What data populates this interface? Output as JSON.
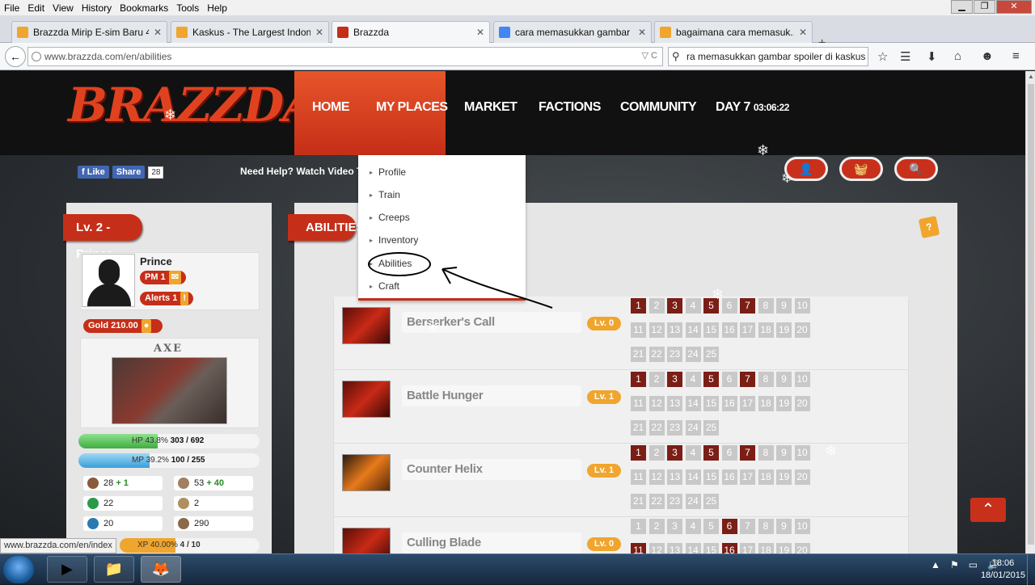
{
  "browser": {
    "menu": [
      "File",
      "Edit",
      "View",
      "History",
      "Bookmarks",
      "Tools",
      "Help"
    ],
    "window_controls": [
      "minimize",
      "restore",
      "close"
    ],
    "tabs": [
      {
        "title": "Brazzda Mirip E-sim Baru 4 ...",
        "active": false,
        "favicon_color": "#f0a52e"
      },
      {
        "title": "Kaskus - The Largest Indon...",
        "active": false,
        "favicon_color": "#f0a52e"
      },
      {
        "title": "Brazzda",
        "active": true,
        "favicon_color": "#c52e18"
      },
      {
        "title": "cara memasukkan gambar ...",
        "active": false,
        "favicon_color": "#4285f4"
      },
      {
        "title": "bagaimana cara memasuk...",
        "active": false,
        "favicon_color": "#f0a52e"
      }
    ],
    "new_tab_label": "+",
    "url": "www.brazzda.com/en/abilities",
    "search_text": "ra memasukkan gambar spoiler di kaskus",
    "status_url": "www.brazzda.com/en/index"
  },
  "site": {
    "logo_text": "BRAZZDA",
    "nav": [
      "HOME",
      "MY PLACES",
      "MARKET",
      "FACTIONS",
      "COMMUNITY"
    ],
    "day_label": "DAY 7",
    "day_time": "03:06:22",
    "fb_like": "Like",
    "fb_share": "Share",
    "fb_count": "28",
    "need_help": "Need Help? Watch Video Tu",
    "dropdown": [
      "Profile",
      "Train",
      "Creeps",
      "Inventory",
      "Abilities",
      "Craft"
    ],
    "action_buttons": [
      "profile-icon",
      "basket-icon",
      "search-icon"
    ]
  },
  "player": {
    "level_label": "Lv. 2 - Prince",
    "name": "Prince",
    "pm_label": "PM 1",
    "alerts_label": "Alerts 1",
    "gold_label": "Gold 210.00",
    "hero": "AXE",
    "hp_pct": "HP 43.8%",
    "hp_val": "303 / 692",
    "hp_fraction": 0.438,
    "mp_pct": "MP 39.2%",
    "mp_val": "100 / 255",
    "mp_fraction": 0.392,
    "xp_pct": "XP 40.00%",
    "xp_val": "4 / 10",
    "xp_fraction": 0.4,
    "stats": [
      {
        "value": "28",
        "bonus": "+ 1",
        "icon": "strength-icon",
        "color": "#8a5a3a"
      },
      {
        "value": "53",
        "bonus": "+ 40",
        "icon": "sword-icon",
        "color": "#a08060"
      },
      {
        "value": "22",
        "bonus": "",
        "icon": "agility-icon",
        "color": "#2a9a4a"
      },
      {
        "value": "2",
        "bonus": "",
        "icon": "armor-icon",
        "color": "#b09060"
      },
      {
        "value": "20",
        "bonus": "",
        "icon": "intelligence-icon",
        "color": "#2a7ab0"
      },
      {
        "value": "290",
        "bonus": "",
        "icon": "boot-icon",
        "color": "#8a6a4a"
      }
    ]
  },
  "abilities": {
    "title": "ABILITIES",
    "levels": [
      "1",
      "2",
      "3",
      "4",
      "5",
      "6",
      "7",
      "8",
      "9",
      "10",
      "11",
      "12",
      "13",
      "14",
      "15",
      "16",
      "17",
      "18",
      "19",
      "20",
      "21",
      "22",
      "23",
      "24",
      "25"
    ],
    "list": [
      {
        "name": "Berserker's Call",
        "level": "Lv. 0",
        "active": [
          1,
          3,
          5,
          7
        ]
      },
      {
        "name": "Battle Hunger",
        "level": "Lv. 1",
        "active": [
          1,
          3,
          5,
          7
        ]
      },
      {
        "name": "Counter Helix",
        "level": "Lv. 1",
        "active": [
          1,
          3,
          5,
          7
        ]
      },
      {
        "name": "Culling Blade",
        "level": "Lv. 0",
        "active": [
          6,
          11,
          16
        ]
      }
    ],
    "help_label": "?"
  },
  "taskbar": {
    "time": "18:06",
    "date": "18/01/2015",
    "apps": [
      "media-player-icon",
      "file-explorer-icon",
      "firefox-icon"
    ]
  }
}
